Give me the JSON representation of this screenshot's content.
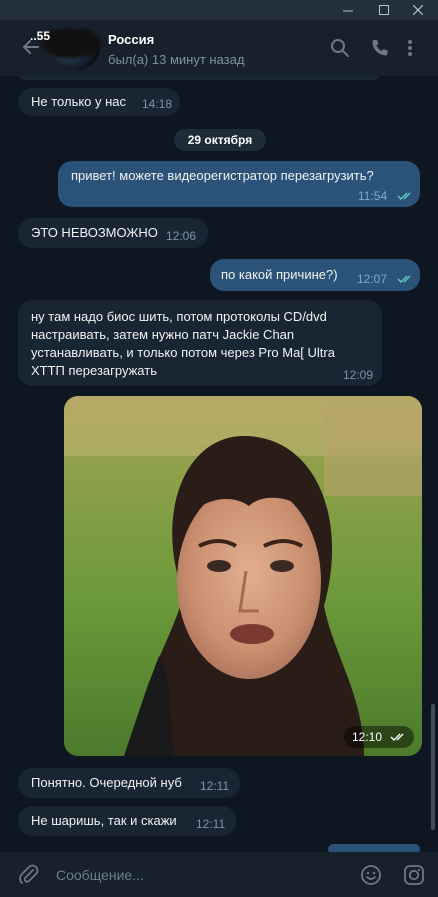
{
  "window": {
    "controls": [
      "minimize",
      "maximize",
      "close"
    ]
  },
  "header": {
    "unread_count": "..55",
    "title": "Россия",
    "status": "был(а) 13 минут назад",
    "icons": [
      "back-arrow-icon",
      "search-icon",
      "phone-icon",
      "more-vertical-icon"
    ]
  },
  "messages": [
    {
      "direction": "in",
      "text": "Не только у нас",
      "time": "14:18"
    },
    {
      "type": "date",
      "text": "29 октября"
    },
    {
      "direction": "out",
      "text": "привет! можете видеорегистратор перезагрузить?",
      "time": "11:54",
      "read": true
    },
    {
      "direction": "in",
      "text": "ЭТО НЕВОЗМОЖНО",
      "time": "12:06"
    },
    {
      "direction": "out",
      "text": "по какой причине?)",
      "time": "12:07",
      "read": true
    },
    {
      "direction": "in",
      "text": "ну там надо биос шить, потом протоколы CD/dvd настраивать, затем нужно патч Jackie Chan устанавливать, и только потом через Pro Ma[ Ultra XTTП перезагружать",
      "time": "12:09"
    },
    {
      "direction": "in",
      "type": "photo",
      "time": "12:10",
      "read": true
    },
    {
      "direction": "in",
      "text": "Понятно. Очередной нуб",
      "time": "12:11"
    },
    {
      "direction": "in",
      "text": "Не шаришь, так и скажи",
      "time": "12:11"
    }
  ],
  "composer": {
    "placeholder": "Сообщение...",
    "value": "",
    "icons": [
      "attach-icon",
      "emoji-icon",
      "instagram-camera-icon"
    ]
  },
  "colors": {
    "background": "#0e1621",
    "header": "#17212b",
    "incoming_bubble": "#182533",
    "outgoing_bubble": "#2b5278",
    "read_ticks": "#5fcfc0"
  }
}
